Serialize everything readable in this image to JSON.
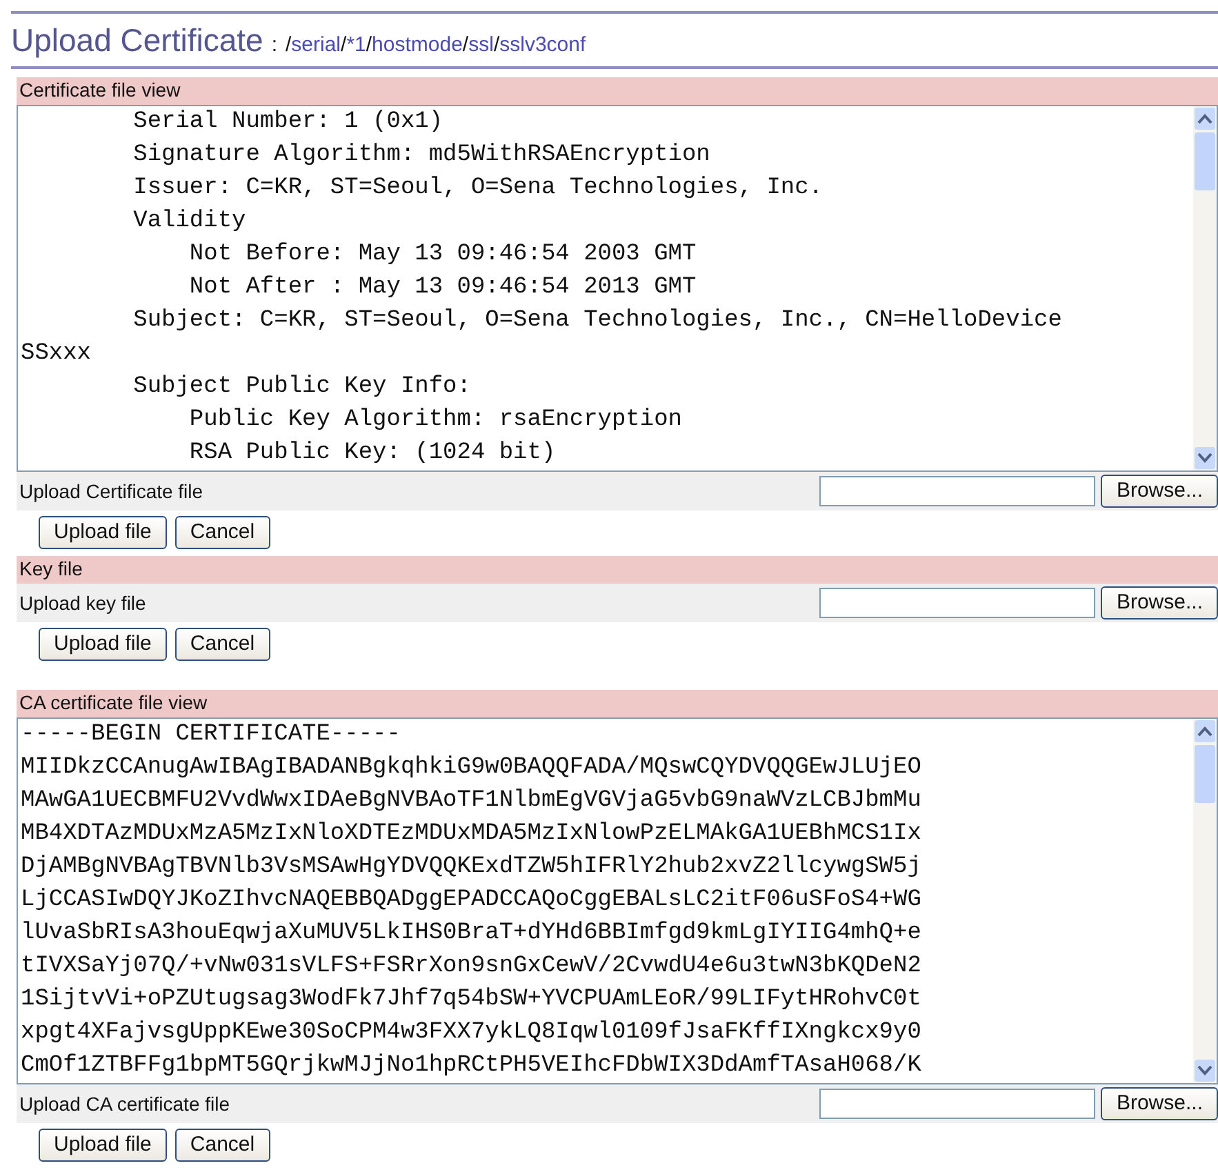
{
  "page": {
    "title": "Upload Certificate",
    "separator": ":",
    "path": [
      {
        "kind": "sep",
        "text": "/"
      },
      {
        "kind": "link",
        "text": "serial"
      },
      {
        "kind": "sep",
        "text": "/"
      },
      {
        "kind": "link",
        "text": "*1"
      },
      {
        "kind": "sep",
        "text": "/"
      },
      {
        "kind": "link",
        "text": "hostmode"
      },
      {
        "kind": "sep",
        "text": "/"
      },
      {
        "kind": "link",
        "text": "ssl"
      },
      {
        "kind": "sep",
        "text": "/"
      },
      {
        "kind": "link",
        "text": "sslv3conf"
      }
    ]
  },
  "sections": [
    {
      "heading": "Certificate file view",
      "viewer_lines": [
        "        Serial Number: 1 (0x1)",
        "        Signature Algorithm: md5WithRSAEncryption",
        "        Issuer: C=KR, ST=Seoul, O=Sena Technologies, Inc.",
        "        Validity",
        "            Not Before: May 13 09:46:54 2003 GMT",
        "            Not After : May 13 09:46:54 2013 GMT",
        "        Subject: C=KR, ST=Seoul, O=Sena Technologies, Inc., CN=HelloDevice",
        "SSxxx",
        "        Subject Public Key Info:",
        "            Public Key Algorithm: rsaEncryption",
        "            RSA Public Key: (1024 bit)"
      ],
      "upload_label": "Upload Certificate file",
      "browse": "Browse...",
      "buttons": [
        "Upload file",
        "Cancel"
      ]
    },
    {
      "heading": "Key file",
      "upload_label": "Upload key file",
      "browse": "Browse...",
      "buttons": [
        "Upload file",
        "Cancel"
      ]
    },
    {
      "heading": "CA certificate file view",
      "viewer_lines": [
        "-----BEGIN CERTIFICATE-----",
        "MIIDkzCCAnugAwIBAgIBADANBgkqhkiG9w0BAQQFADA/MQswCQYDVQQGEwJLUjEO",
        "MAwGA1UECBMFU2VvdWwxIDAeBgNVBAoTF1NlbmEgVGVjaG5vbG9naWVzLCBJbmMu",
        "MB4XDTAzMDUxMzA5MzIxNloXDTEzMDUxMDA5MzIxNlowPzELMAkGA1UEBhMCS1Ix",
        "DjAMBgNVBAgTBVNlb3VsMSAwHgYDVQQKExdTZW5hIFRlY2hub2xvZ2llcywgSW5j",
        "LjCCASIwDQYJKoZIhvcNAQEBBQADggEPADCCAQoCggEBALsLC2itF06uSFoS4+WG",
        "lUvaSbRIsA3houEqwjaXuMUV5LkIHS0BraT+dYHd6BBImfgd9kmLgIYIIG4mhQ+e",
        "tIVXSaYj07Q/+vNw031sVLFS+FSRrXon9snGxCewV/2CvwdU4e6u3twN3bKQDeN2",
        "1SijtvVi+oPZUtugsag3WodFk7Jhf7q54bSW+YVCPUAmLEoR/99LIFytHRohvC0t",
        "xpgt4XFajvsgUppKEwe30SoCPM4w3FXX7ykLQ8Iqwl0109fJsaFKffIXngkcx9y0",
        "CmOf1ZTBFFg1bpMT5GQrjkwMJjNo1hpRCtPH5VEIhcFDbWIX3DdAmfTAsaH068/K"
      ],
      "upload_label": "Upload CA certificate file",
      "browse": "Browse...",
      "buttons": [
        "Upload file",
        "Cancel"
      ]
    }
  ]
}
